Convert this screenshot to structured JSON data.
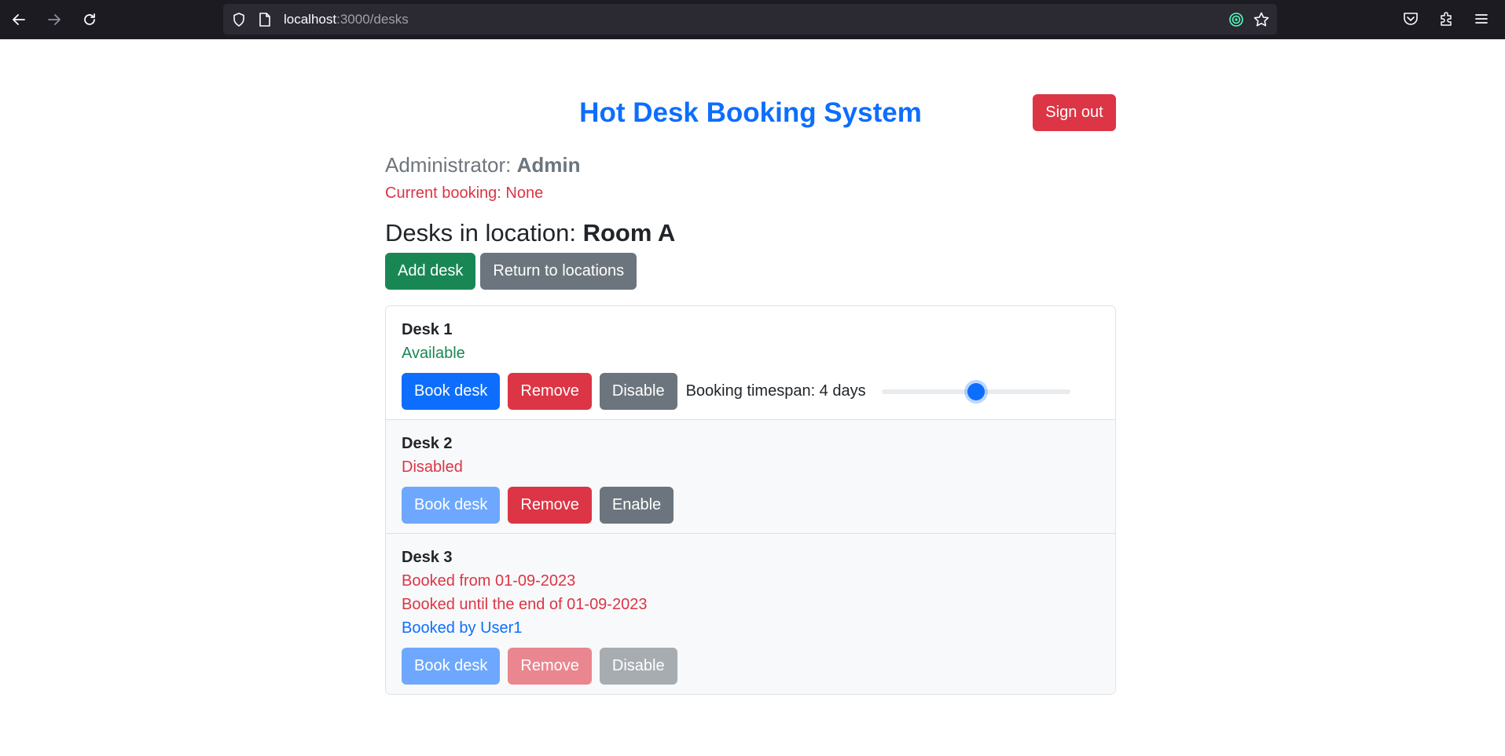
{
  "browser": {
    "url_host": "localhost",
    "url_path": ":3000/desks",
    "icons": [
      "back-icon",
      "forward-icon",
      "reload-icon",
      "shield-icon",
      "page-icon",
      "tracking-icon",
      "bookmark-star-icon",
      "pocket-icon",
      "extensions-icon",
      "menu-icon"
    ]
  },
  "header": {
    "title": "Hot Desk Booking System",
    "signout_label": "Sign out"
  },
  "user": {
    "role_label": "Administrator: ",
    "name": "Admin",
    "current_booking": "Current booking: None"
  },
  "location": {
    "heading_prefix": "Desks in location: ",
    "name": "Room A",
    "add_desk_label": "Add desk",
    "return_label": "Return to locations"
  },
  "desks": [
    {
      "name": "Desk 1",
      "status": "Available",
      "book_label": "Book desk",
      "remove_label": "Remove",
      "toggle_label": "Disable",
      "timespan_label": "Booking timespan: 4 days",
      "timespan_fraction": 0.5
    },
    {
      "name": "Desk 2",
      "status": "Disabled",
      "book_label": "Book desk",
      "remove_label": "Remove",
      "toggle_label": "Enable"
    },
    {
      "name": "Desk 3",
      "booked_from": "Booked from 01-09-2023",
      "booked_until": "Booked until the end of 01-09-2023",
      "booked_by": "Booked by User1",
      "book_label": "Book desk",
      "remove_label": "Remove",
      "toggle_label": "Disable"
    }
  ],
  "colors": {
    "primary": "#0d6efd",
    "danger": "#dc3545",
    "success": "#198754",
    "secondary": "#6c757d"
  }
}
